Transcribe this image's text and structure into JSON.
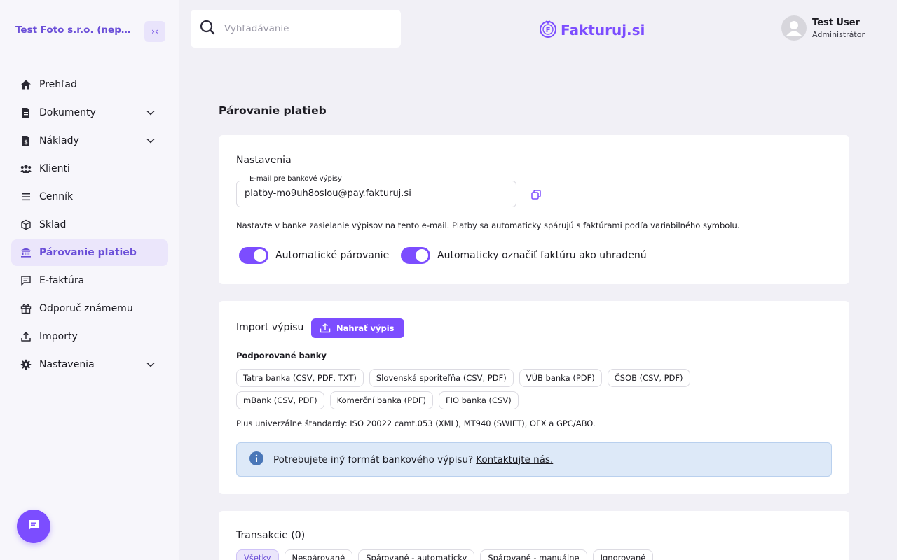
{
  "sidebar": {
    "company": "Test Foto s.r.o. (neplat...",
    "collapse_label": "›‹",
    "items": [
      {
        "label": "Prehľad"
      },
      {
        "label": "Dokumenty"
      },
      {
        "label": "Náklady"
      },
      {
        "label": "Klienti"
      },
      {
        "label": "Cenník"
      },
      {
        "label": "Sklad"
      },
      {
        "label": "Párovanie platieb"
      },
      {
        "label": "E-faktúra"
      },
      {
        "label": "Odporuč známemu"
      },
      {
        "label": "Importy"
      },
      {
        "label": "Nastavenia"
      }
    ]
  },
  "header": {
    "search_placeholder": "Vyhľadávanie",
    "logo": "Fakturuj.si",
    "user_name": "Test User",
    "user_role": "Administrátor"
  },
  "page": {
    "title": "Párovanie platieb"
  },
  "settings": {
    "title": "Nastavenia",
    "email_label": "E-mail pre bankové výpisy",
    "email_value": "platby-mo9uh8oslou@pay.fakturuj.si",
    "hint": "Nastavte v banke zasielanie výpisov na tento e-mail. Platby sa automaticky spárujú s faktúrami podľa variabilného symbolu.",
    "toggle1": "Automatické párovanie",
    "toggle2": "Automaticky označiť faktúru ako uhradenú"
  },
  "import": {
    "title": "Import výpisu",
    "upload_label": "Nahrať výpis",
    "banks_title": "Podporované banky",
    "banks": [
      "Tatra banka (CSV, PDF, TXT)",
      "Slovenská sporiteľňa (CSV, PDF)",
      "VÚB banka (PDF)",
      "ČSOB (CSV, PDF)",
      "mBank (CSV, PDF)",
      "Komerční banka (PDF)",
      "FIO banka (CSV)"
    ],
    "standards": "Plus univerzálne štandardy: ISO 20022 camt.053 (XML), MT940 (SWIFT), OFX a GPC/ABO.",
    "info_text": "Potrebujete iný formát bankového výpisu?",
    "info_link": "Kontaktujte nás."
  },
  "transactions": {
    "title": "Transakcie (0)",
    "filters": [
      "Všetky",
      "Nespárované",
      "Spárované - automaticky",
      "Spárované - manuálne",
      "Ignorované"
    ]
  },
  "colors": {
    "accent": "#7c4dff",
    "accent_text": "#6b4fd8",
    "active_bg": "#ebe6fb",
    "info_bg": "#dde9f8"
  }
}
